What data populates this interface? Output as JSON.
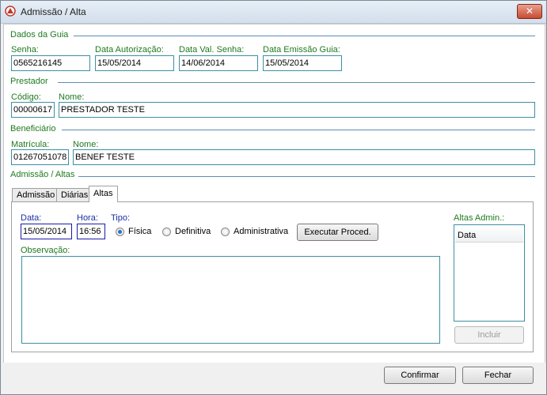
{
  "window": {
    "title": "Admissão / Alta",
    "close_label": "✕"
  },
  "dados_guia": {
    "section": "Dados da Guia",
    "senha_label": "Senha:",
    "senha": "0565216145",
    "data_autorizacao_label": "Data Autorização:",
    "data_autorizacao": "15/05/2014",
    "data_val_senha_label": "Data Val. Senha:",
    "data_val_senha": "14/06/2014",
    "data_emissao_label": "Data Emissão Guia:",
    "data_emissao": "15/05/2014"
  },
  "prestador": {
    "section": "Prestador",
    "codigo_label": "Código:",
    "codigo": "00000617",
    "nome_label": "Nome:",
    "nome": "PRESTADOR TESTE"
  },
  "beneficiario": {
    "section": "Beneficiário",
    "matricula_label": "Matrícula:",
    "matricula": "01267051078",
    "nome_label": "Nome:",
    "nome": "BENEF TESTE"
  },
  "admissao_altas": {
    "section": "Admissão / Altas",
    "tabs": [
      {
        "label": "Admissão"
      },
      {
        "label": "Diárias"
      },
      {
        "label": "Altas"
      }
    ],
    "altas": {
      "data_label": "Data:",
      "data": "15/05/2014",
      "hora_label": "Hora:",
      "hora": "16:56",
      "tipo_label": "Tipo:",
      "tipo_options": [
        "Física",
        "Definitiva",
        "Administrativa"
      ],
      "tipo_selected": "Física",
      "executar_label": "Executar Proced.",
      "observacao_label": "Observação:",
      "observacao": "",
      "altas_admin_label": "Altas Admin.:",
      "list_header": "Data",
      "incluir_label": "Incluir"
    }
  },
  "footer": {
    "confirmar_label": "Confirmar",
    "fechar_label": "Fechar"
  },
  "colors": {
    "label_green": "#1f7a1f",
    "label_blue": "#1a2fa8",
    "field_border": "#3d8fa5"
  }
}
